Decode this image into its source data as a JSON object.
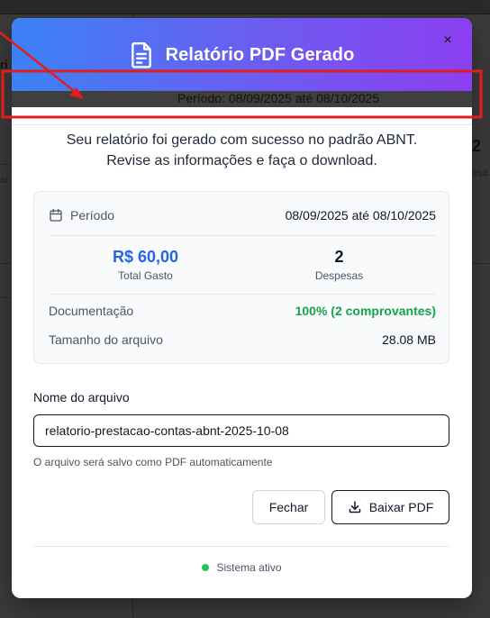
{
  "background": {
    "fragments": [
      "ri",
      "2",
      "esa",
      "ar"
    ]
  },
  "modal": {
    "title": "Relatório PDF Gerado",
    "close_glyph": "×",
    "behind_strip_text": "Período: 08/09/2025 até 08/10/2025",
    "intro_line1": "Seu relatório foi gerado com sucesso no padrão ABNT.",
    "intro_line2": "Revise as informações e faça o download.",
    "summary": {
      "period_label": "Período",
      "period_value": "08/09/2025 até 08/10/2025",
      "total_value": "R$ 60,00",
      "total_label": "Total Gasto",
      "count_value": "2",
      "count_label": "Despesas",
      "documentation_label": "Documentação",
      "documentation_value": "100% (2 comprovantes)",
      "size_label": "Tamanho do arquivo",
      "size_value": "28.08 MB"
    },
    "filename": {
      "label": "Nome do arquivo",
      "value": "relatorio-prestacao-contas-abnt-2025-10-08",
      "hint": "O arquivo será salvo como PDF automaticamente"
    },
    "buttons": {
      "close_label": "Fechar",
      "download_label": "Baixar PDF"
    },
    "status_text": "Sistema ativo"
  },
  "icons": {
    "header": "document-icon",
    "period": "calendar-icon",
    "download": "download-icon",
    "close": "close-icon"
  },
  "colors": {
    "header_gradient_start": "#3b82f6",
    "header_gradient_end": "#8b3ff0",
    "total_blue": "#2563eb",
    "success_green": "#16a34a",
    "status_dot": "#22c55e",
    "annotation_red": "#e11d1d"
  }
}
